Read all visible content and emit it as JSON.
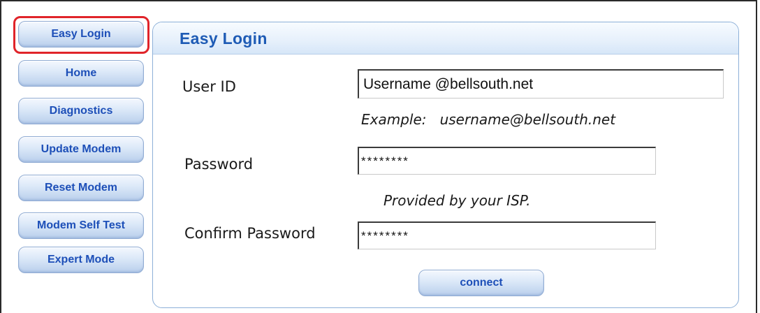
{
  "sidebar": {
    "items": [
      {
        "label": "Easy Login",
        "selected": true
      },
      {
        "label": "Home",
        "selected": false
      },
      {
        "label": "Diagnostics",
        "selected": false
      },
      {
        "label": "Update Modem",
        "selected": false
      },
      {
        "label": "Reset Modem",
        "selected": false
      },
      {
        "label": "Modem Self Test",
        "selected": false
      },
      {
        "label": "Expert Mode",
        "selected": false
      }
    ]
  },
  "panel": {
    "title": "Easy Login",
    "user_id": {
      "label": "User ID",
      "value": "Username @bellsouth.net",
      "hint": "Example:   username@bellsouth.net"
    },
    "password": {
      "label": "Password",
      "value": "********",
      "hint": "Provided by your ISP."
    },
    "confirm_password": {
      "label": "Confirm Password",
      "value": "********"
    },
    "connect_label": "connect"
  },
  "colors": {
    "accent": "#1d4fb8",
    "title": "#1e5bb5",
    "selected_outline": "#e0242a",
    "panel_border": "#8db0d8"
  }
}
